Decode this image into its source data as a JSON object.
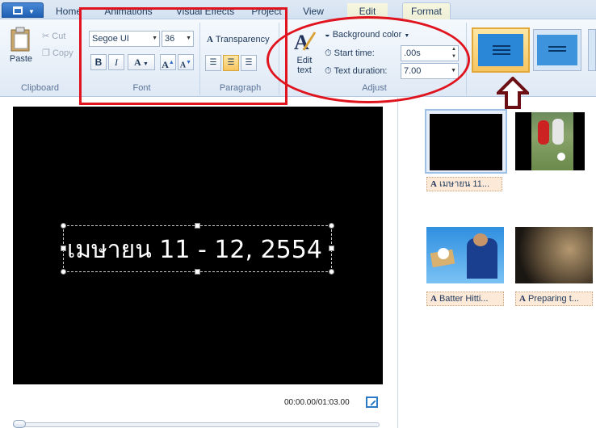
{
  "tabs": [
    {
      "label": "Home"
    },
    {
      "label": "Animations"
    },
    {
      "label": "Visual Effects"
    },
    {
      "label": "Project"
    },
    {
      "label": "View"
    },
    {
      "label": "Edit"
    },
    {
      "label": "Format"
    }
  ],
  "clipboard": {
    "group_label": "Clipboard",
    "paste": "Paste",
    "cut": "Cut",
    "copy": "Copy"
  },
  "font": {
    "group_label": "Font",
    "family": "Segoe UI",
    "size": "36",
    "bold": "B",
    "italic": "I",
    "color": "A",
    "grow": "A",
    "shrink": "A"
  },
  "paragraph": {
    "group_label": "Paragraph",
    "transparency": "Transparency"
  },
  "adjust": {
    "group_label": "Adjust",
    "edit_text_line1": "Edit",
    "edit_text_line2": "text",
    "background_color": "Background color",
    "start_time_label": "Start time:",
    "start_time_value": ".00s",
    "duration_label": "Text duration:",
    "duration_value": "7.00"
  },
  "preview": {
    "caption": "เมษายน 11 - 12, 2554",
    "timecode": "00:00.00/01:03.00"
  },
  "storyboard": {
    "clips": [
      {
        "caption": "เมษายน 11..."
      },
      {
        "caption": ""
      },
      {
        "caption": "Batter Hitti..."
      },
      {
        "caption": "Preparing t..."
      }
    ]
  },
  "colors": {
    "annotation_red": "#e0141e",
    "arrow_fill": "#6b0f14",
    "selected_gold": "#f7c561"
  }
}
